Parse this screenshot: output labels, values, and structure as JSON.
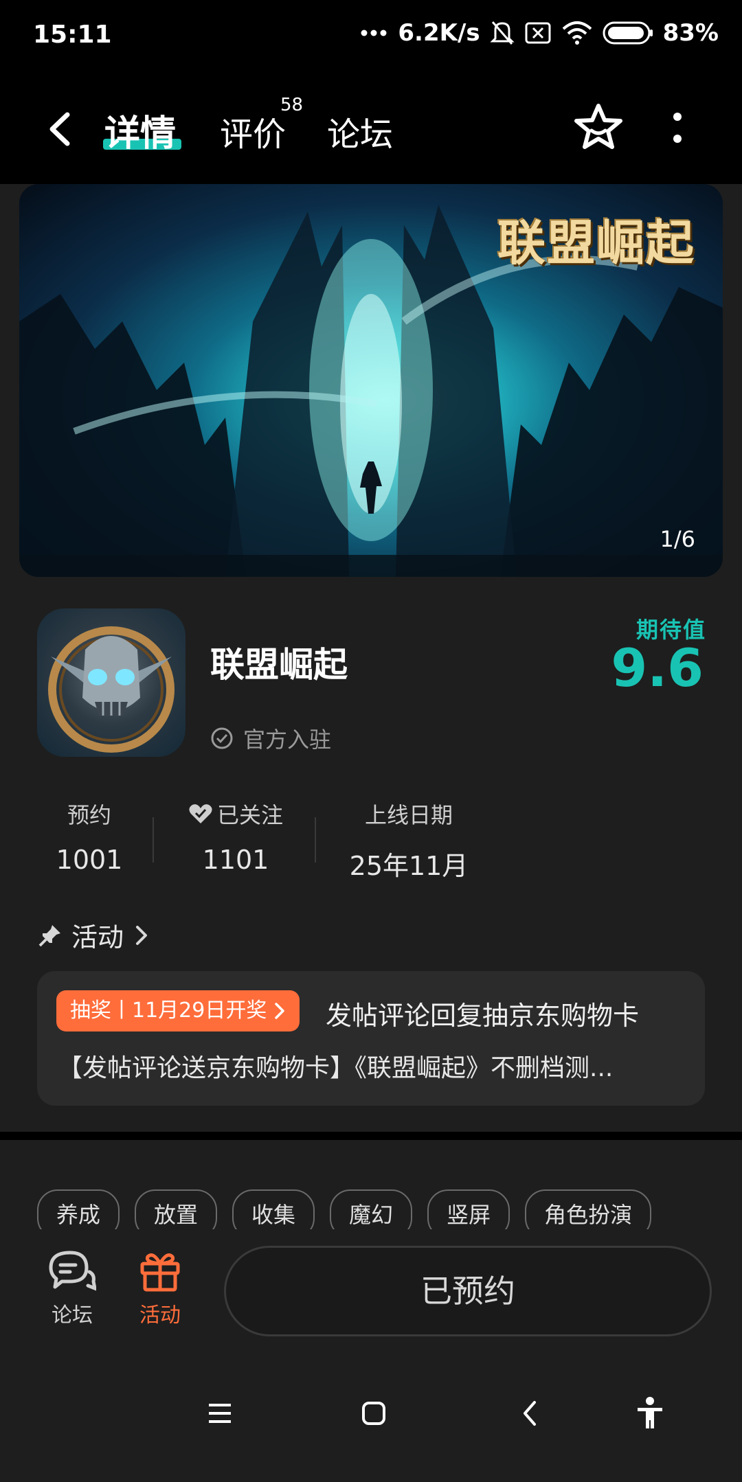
{
  "status_bar": {
    "time": "15:11",
    "network_speed": "6.2K/s",
    "battery": "83%"
  },
  "header": {
    "tabs": [
      {
        "label": "详情",
        "active": true
      },
      {
        "label": "评价",
        "badge": "58"
      },
      {
        "label": "论坛"
      }
    ]
  },
  "banner": {
    "logo_text": "联盟崛起",
    "counter": "1/6"
  },
  "app": {
    "name": "联盟崛起",
    "verified_label": "官方入驻",
    "expect_label": "期待值",
    "expect_score": "9.6"
  },
  "stats": [
    {
      "label": "预约",
      "value": "1001"
    },
    {
      "label": "已关注",
      "value": "1101"
    },
    {
      "label": "上线日期",
      "value": "25年11月"
    }
  ],
  "activity": {
    "section_label": "活动",
    "tag": "抽奖丨11月29日开奖",
    "title": "发帖评论回复抽京东购物卡",
    "description": "【发帖评论送京东购物卡】《联盟崛起》不删档测..."
  },
  "tags": [
    "养成",
    "放置",
    "收集",
    "魔幻",
    "竖屏",
    "角色扮演"
  ],
  "action_bar": {
    "forum_label": "论坛",
    "activity_label": "活动",
    "reserve_label": "已预约"
  },
  "colors": {
    "accent": "#19c3b3",
    "orange": "#ff6d3b",
    "background": "#1e1e1e"
  }
}
